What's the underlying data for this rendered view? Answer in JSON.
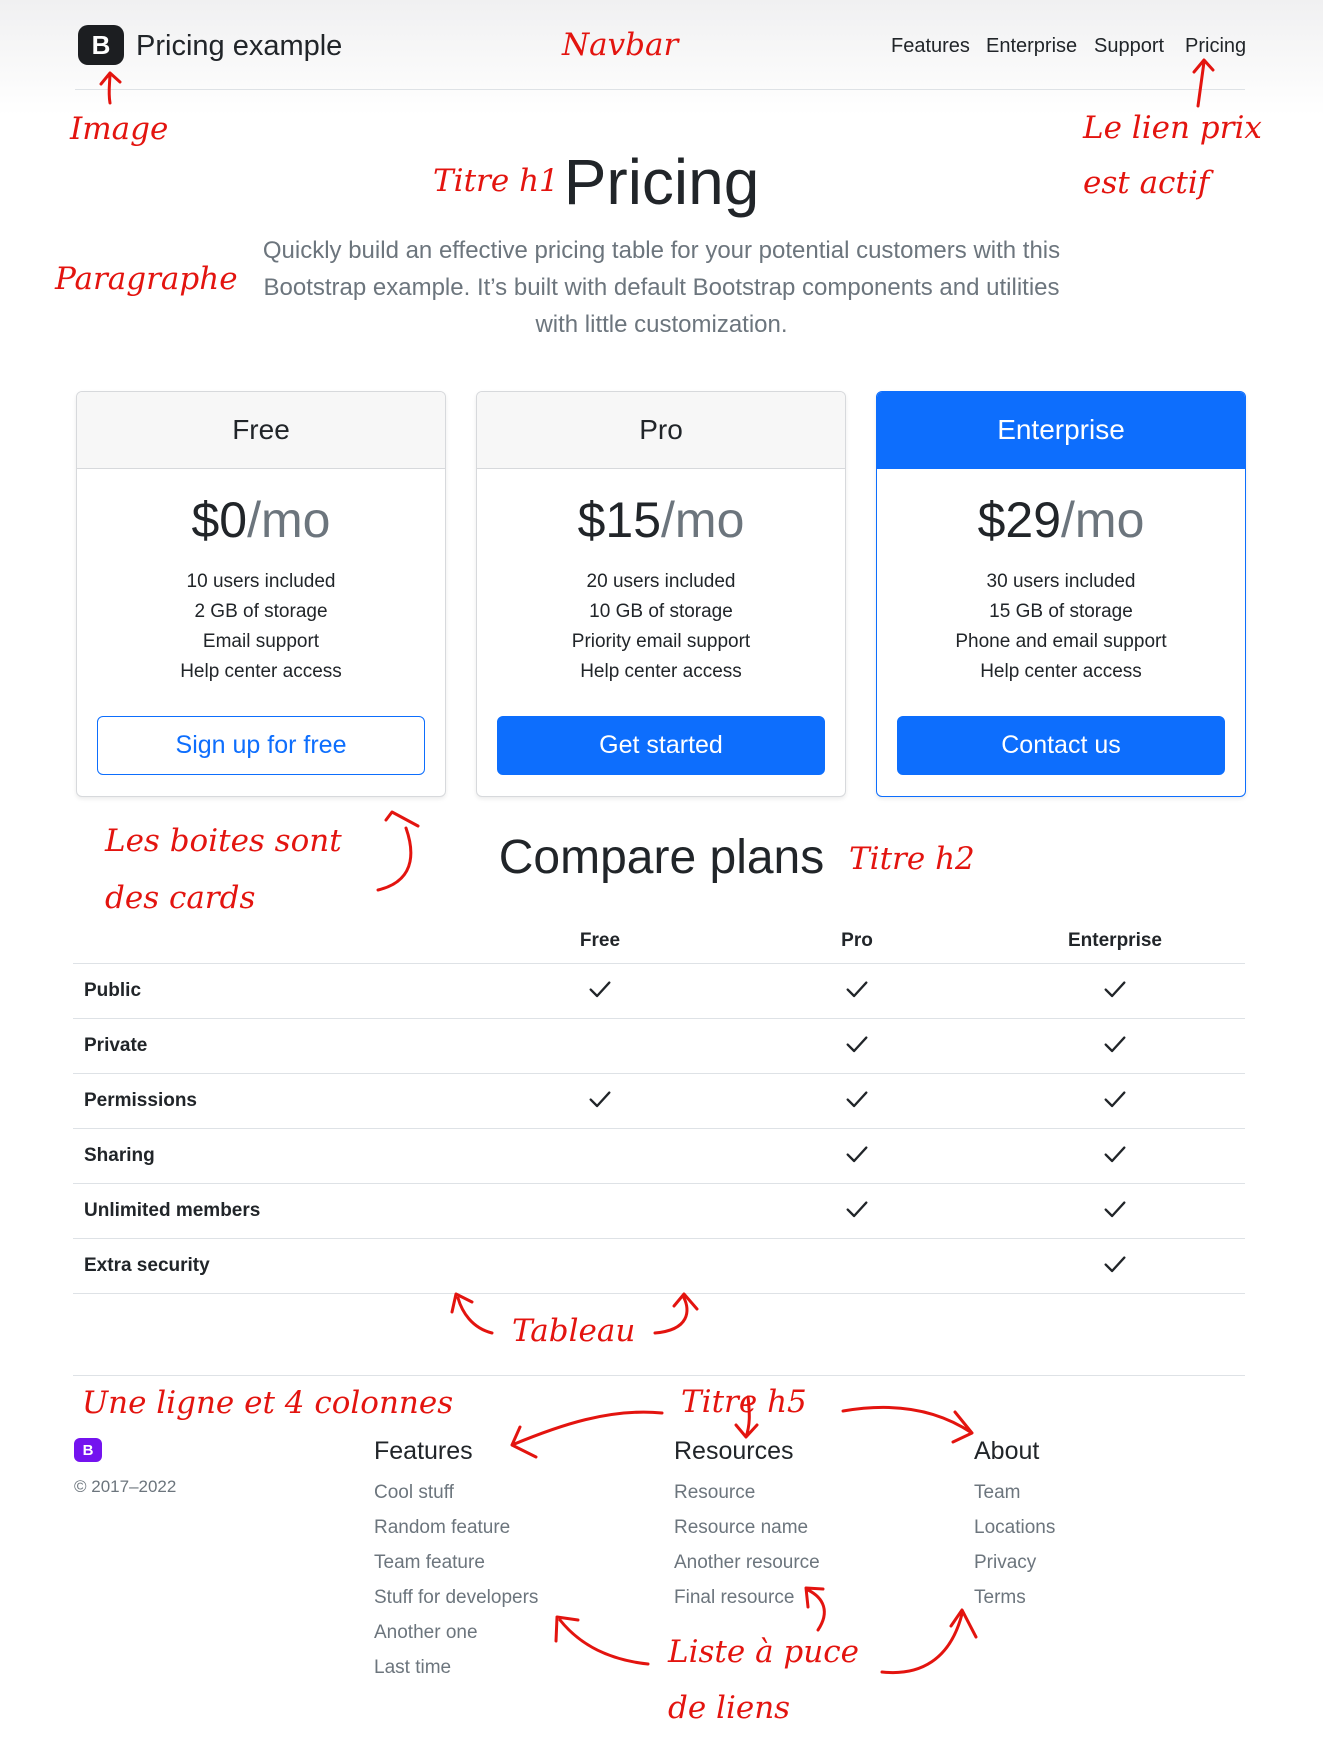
{
  "navbar": {
    "brand_letter": "B",
    "brand": "Pricing example",
    "links": [
      "Features",
      "Enterprise",
      "Support",
      "Pricing"
    ]
  },
  "hero": {
    "title": "Pricing",
    "lead": "Quickly build an effective pricing table for your potential customers with this Bootstrap example. It’s built with default Bootstrap components and utilities with little customization."
  },
  "cards": [
    {
      "title": "Free",
      "price": "$0",
      "per": "/mo",
      "features": [
        "10 users included",
        "2 GB of storage",
        "Email support",
        "Help center access"
      ],
      "button": "Sign up for free"
    },
    {
      "title": "Pro",
      "price": "$15",
      "per": "/mo",
      "features": [
        "20 users included",
        "10 GB of storage",
        "Priority email support",
        "Help center access"
      ],
      "button": "Get started"
    },
    {
      "title": "Enterprise",
      "price": "$29",
      "per": "/mo",
      "features": [
        "30 users included",
        "15 GB of storage",
        "Phone and email support",
        "Help center access"
      ],
      "button": "Contact us"
    }
  ],
  "compare": {
    "title": "Compare plans",
    "headers": [
      "Free",
      "Pro",
      "Enterprise"
    ],
    "rows": [
      {
        "label": "Public",
        "checks": [
          true,
          true,
          true
        ]
      },
      {
        "label": "Private",
        "checks": [
          false,
          true,
          true
        ]
      },
      {
        "label": "Permissions",
        "checks": [
          true,
          true,
          true
        ]
      },
      {
        "label": "Sharing",
        "checks": [
          false,
          true,
          true
        ]
      },
      {
        "label": "Unlimited members",
        "checks": [
          false,
          true,
          true
        ]
      },
      {
        "label": "Extra security",
        "checks": [
          false,
          false,
          true
        ]
      }
    ]
  },
  "footer": {
    "logo_letter": "B",
    "copyright": "© 2017–2022",
    "columns": [
      {
        "title": "Features",
        "links": [
          "Cool stuff",
          "Random feature",
          "Team feature",
          "Stuff for developers",
          "Another one",
          "Last time"
        ]
      },
      {
        "title": "Resources",
        "links": [
          "Resource",
          "Resource name",
          "Another resource",
          "Final resource"
        ]
      },
      {
        "title": "About",
        "links": [
          "Team",
          "Locations",
          "Privacy",
          "Terms"
        ]
      }
    ]
  },
  "annotations": {
    "navbar": "Navbar",
    "image": "Image",
    "active_1": "Le lien prix",
    "active_2": "est actif",
    "h1": "Titre h1",
    "paragraph": "Paragraphe",
    "cards_1": "Les boites sont",
    "cards_2": "des cards",
    "h2": "Titre h2",
    "table": "Tableau",
    "row": "Une ligne et 4 colonnes",
    "h5": "Titre h5",
    "list_1": "Liste à puce",
    "list_2": "de liens"
  },
  "colors": {
    "primary": "#0d6efd",
    "annotation": "#e3140f",
    "footer_logo": "#7413ef"
  },
  "icons": {
    "check": "check-icon"
  }
}
